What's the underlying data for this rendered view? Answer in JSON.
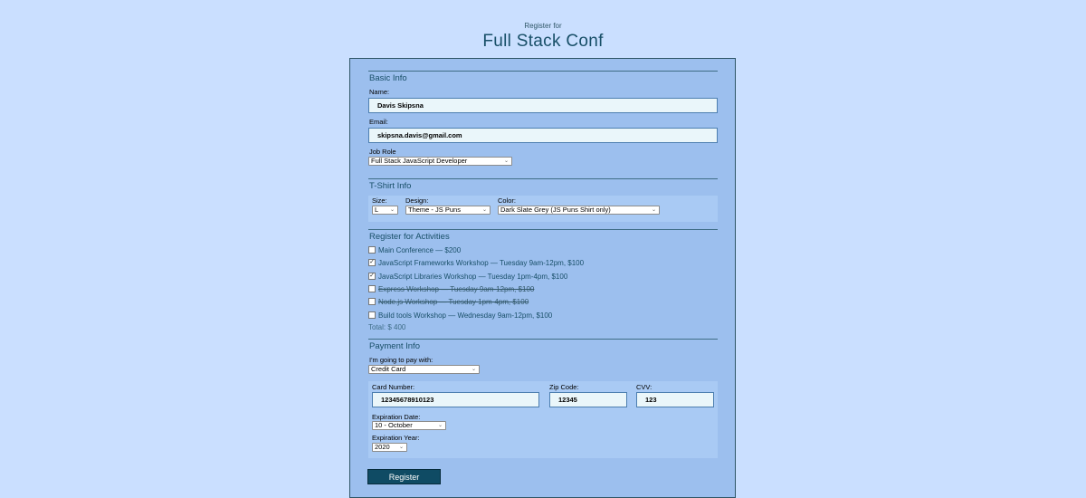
{
  "header": {
    "subtitle": "Register for",
    "title": "Full Stack Conf"
  },
  "basic_info": {
    "legend": "Basic Info",
    "name_label": "Name:",
    "name_value": "Davis Skipsna",
    "email_label": "Email:",
    "email_value": "skipsna.davis@gmail.com",
    "job_role_label": "Job Role",
    "job_role_value": "Full Stack JavaScript Developer"
  },
  "tshirt": {
    "legend": "T-Shirt Info",
    "size_label": "Size:",
    "size_value": "L",
    "design_label": "Design:",
    "design_value": "Theme - JS Puns",
    "color_label": "Color:",
    "color_value": "Dark Slate Grey (JS Puns Shirt only)"
  },
  "activities": {
    "legend": "Register for Activities",
    "items": [
      {
        "label": "Main Conference — $200",
        "checked": false,
        "disabled": false
      },
      {
        "label": "JavaScript Frameworks Workshop — Tuesday 9am-12pm, $100",
        "checked": true,
        "disabled": false
      },
      {
        "label": "JavaScript Libraries Workshop — Tuesday 1pm-4pm, $100",
        "checked": true,
        "disabled": false
      },
      {
        "label": "Express Workshop — Tuesday 9am-12pm, $100",
        "checked": false,
        "disabled": true
      },
      {
        "label": "Node.js Workshop — Tuesday 1pm-4pm, $100",
        "checked": false,
        "disabled": true
      },
      {
        "label": "Build tools Workshop — Wednesday 9am-12pm, $100",
        "checked": false,
        "disabled": false
      }
    ],
    "total": "Total: $ 400"
  },
  "payment": {
    "legend": "Payment Info",
    "method_label": "I'm going to pay with:",
    "method_value": "Credit Card",
    "card_number_label": "Card Number:",
    "card_number_value": "12345678910123",
    "zip_label": "Zip Code:",
    "zip_value": "12345",
    "cvv_label": "CVV:",
    "cvv_value": "123",
    "exp_date_label": "Expiration Date:",
    "exp_date_value": "10 - October",
    "exp_year_label": "Expiration Year:",
    "exp_year_value": "2020"
  },
  "submit": {
    "label": "Register"
  },
  "icons": {
    "dropdown": "chevron-down-icon",
    "check": "checkmark-icon"
  },
  "colors": {
    "page_bg": "#cadfff",
    "form_bg": "#9cbfee",
    "button_bg": "#0f4b64",
    "heading": "#184f68"
  }
}
